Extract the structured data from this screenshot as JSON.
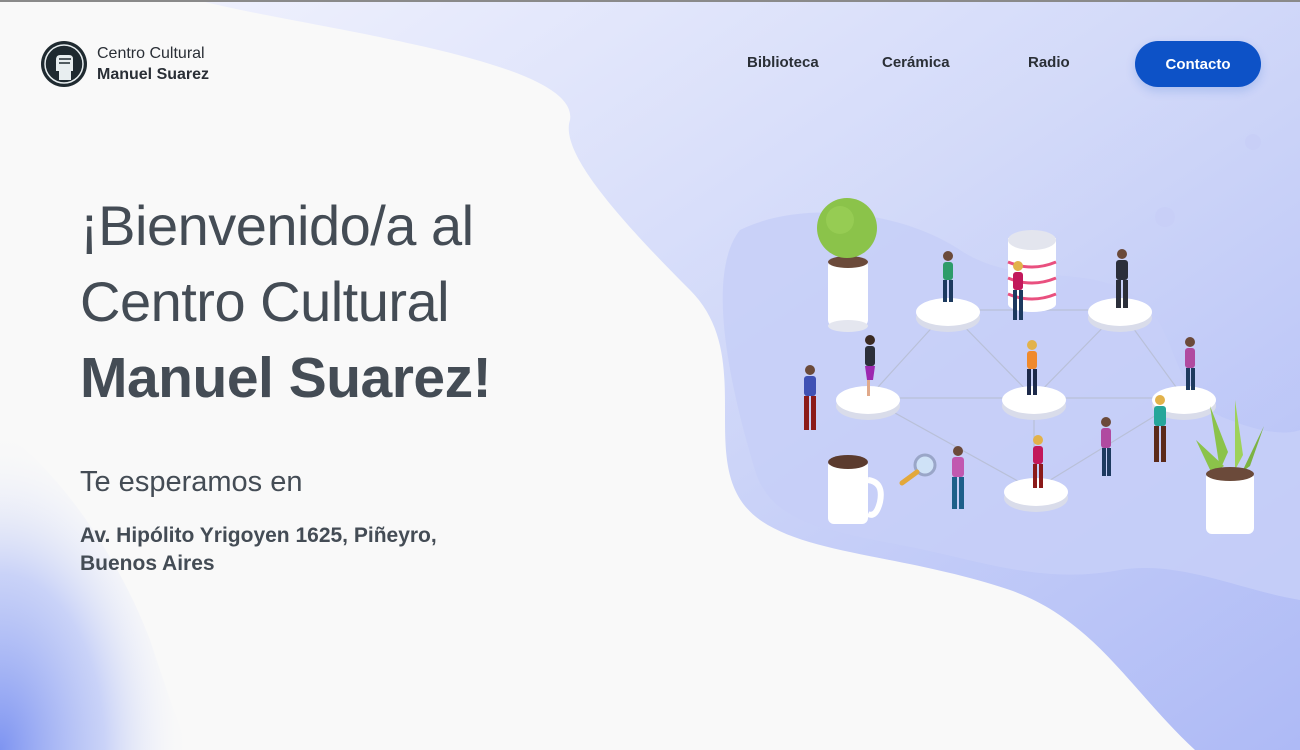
{
  "brand": {
    "line1": "Centro Cultural",
    "line2": "Manuel Suarez",
    "logo_icon": "raised-fist-icon"
  },
  "nav": {
    "items": [
      {
        "label": "Biblioteca"
      },
      {
        "label": "Cerámica"
      },
      {
        "label": "Radio"
      }
    ],
    "contact_label": "Contacto"
  },
  "hero": {
    "line1": "¡Bienvenido/a al",
    "line2": "Centro Cultural",
    "line3": "Manuel Suarez!"
  },
  "info": {
    "subtitle": "Te esperamos en",
    "address": "Av. Hipólito Yrigoyen 1625, Piñeyro, Buenos Aires"
  },
  "colors": {
    "accent": "#0d52c7",
    "text": "#444c55",
    "blob": "#c3cbf8",
    "background": "#f9f9f9"
  }
}
